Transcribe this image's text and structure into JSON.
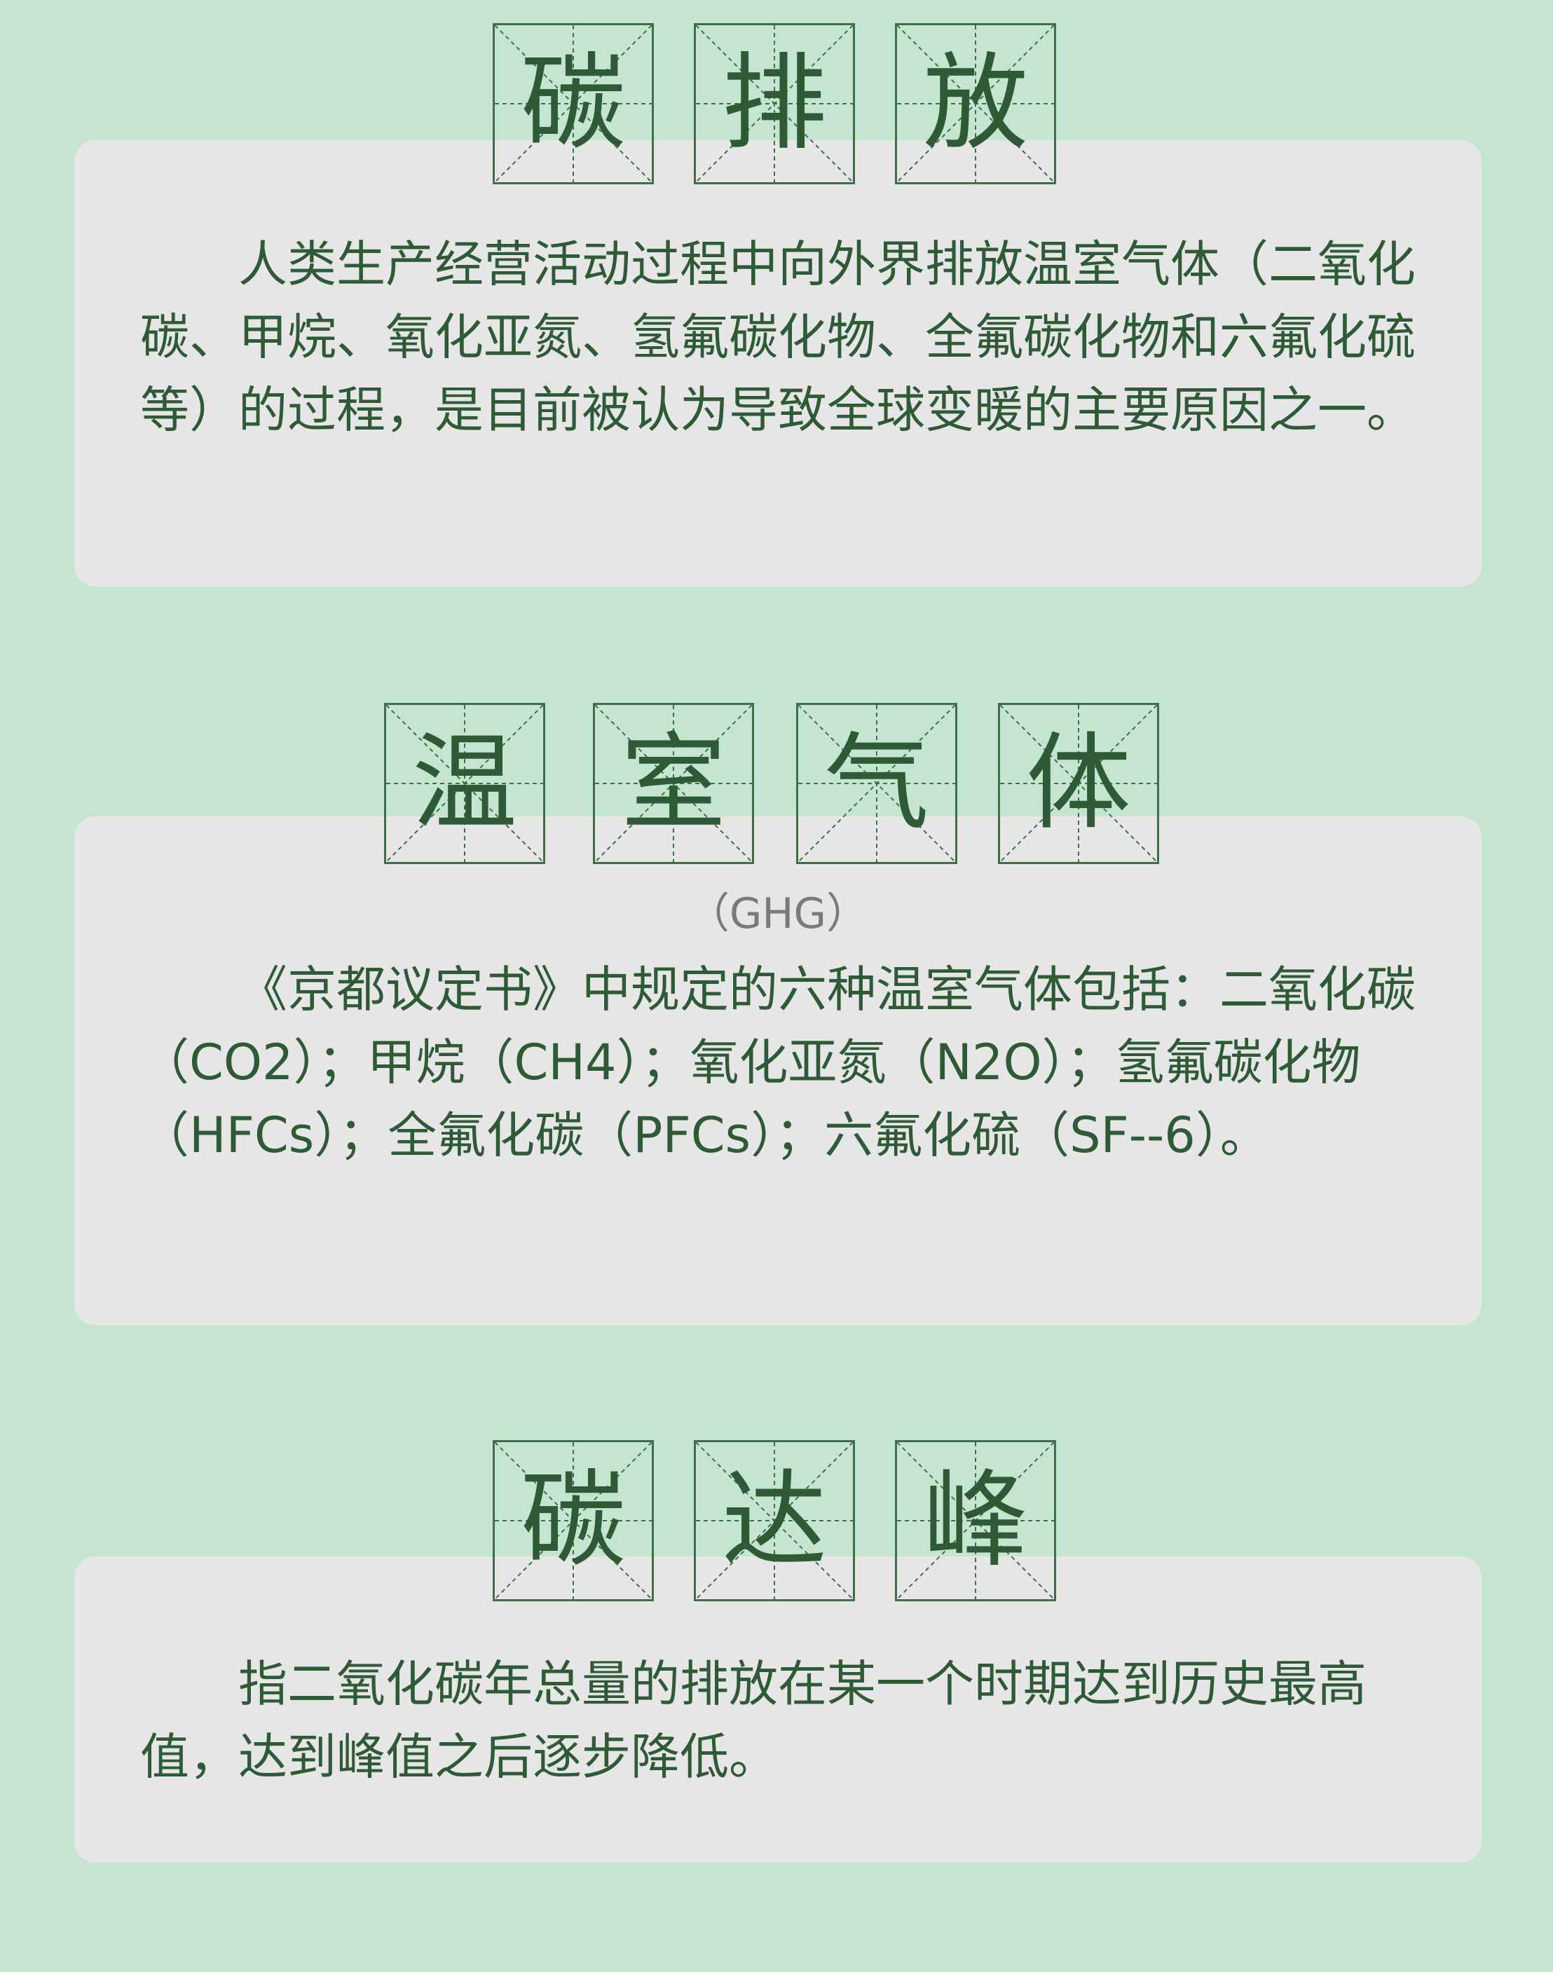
{
  "sections": [
    {
      "title_chars": [
        "碳",
        "排",
        "放"
      ],
      "body": "人类生产经营活动过程中向外界排放温室气体（二氧化碳、甲烷、氧化亚氮、氢氟碳化物、全氟碳化物和六氟化硫等）的过程，是目前被认为导致全球变暖的主要原因之一。"
    },
    {
      "title_chars": [
        "温",
        "室",
        "气",
        "体"
      ],
      "subtitle": "（GHG）",
      "body": "《京都议定书》中规定的六种温室气体包括：二氧化碳（CO2）；甲烷（CH4）；氧化亚氮（N2O）；氢氟碳化物（HFCs）；全氟化碳（PFCs）；六氟化硫（SF--6）。"
    },
    {
      "title_chars": [
        "碳",
        "达",
        "峰"
      ],
      "body": "指二氧化碳年总量的排放在某一个时期达到历史最高值，达到峰值之后逐步降低。"
    }
  ],
  "colors": {
    "background": "#c6e5d0",
    "card": "#e6e6e6",
    "text": "#2e5a36",
    "grid_line": "#3f6e48",
    "subtitle": "#7a7a7a"
  }
}
